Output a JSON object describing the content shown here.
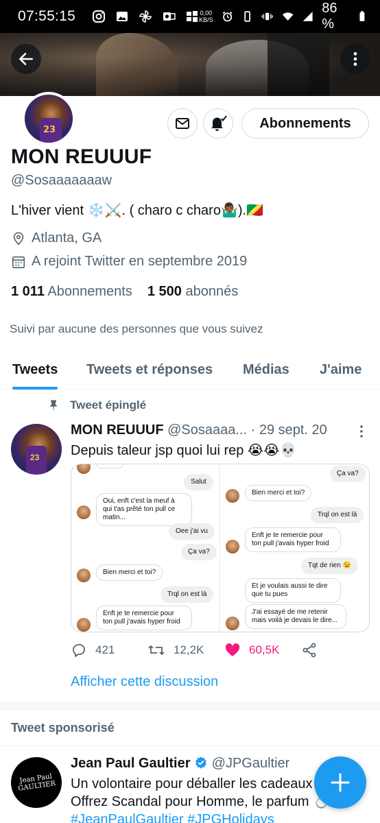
{
  "status_bar": {
    "time": "07:55:15",
    "net_speed_value": "0,00",
    "net_speed_unit": "KB/S",
    "battery": "86 %"
  },
  "profile": {
    "display_name": "MON REUUUF",
    "handle": "@Sosaaaaaaaw",
    "bio": "L'hiver vient ❄️⚔️. ( charo c charo🤷🏾‍♂️).🇨🇬",
    "location": "Atlanta, GA",
    "joined": "A rejoint Twitter en septembre 2019",
    "following_count": "1 011",
    "following_label": "Abonnements",
    "followers_count": "1 500",
    "followers_label": "abonnés",
    "followed_by": "Suivi par aucune des personnes que vous suivez",
    "follow_button": "Abonnements"
  },
  "tabs": [
    {
      "label": "Tweets",
      "active": true
    },
    {
      "label": "Tweets et réponses",
      "active": false
    },
    {
      "label": "Médias",
      "active": false
    },
    {
      "label": "J'aime",
      "active": false
    }
  ],
  "pinned_tweet": {
    "pinned_label": "Tweet épinglé",
    "author_name": "MON REUUUF",
    "author_handle": "@Sosaaaa...",
    "date": "· 29 sept. 20",
    "text": "Depuis taleur jsp quoi lui rep 😭😭💀",
    "media_left": [
      {
        "text": "Salut",
        "from": "me"
      },
      {
        "text": "Oui, enft c'est la meuf à qui t'as prêté ton pull ce matin...",
        "from": "them"
      },
      {
        "text": "Oee j'ai vu",
        "from": "me"
      },
      {
        "text": "Ça va?",
        "from": "me"
      },
      {
        "text": "Bien merci et toi?",
        "from": "them"
      },
      {
        "text": "Trql on est là",
        "from": "me"
      },
      {
        "text": "Enft je te remercie pour ton pull j'avais hyper froid",
        "from": "them"
      }
    ],
    "media_right": [
      {
        "text": "Ça va?",
        "from": "me"
      },
      {
        "text": "Bien merci et toi?",
        "from": "them"
      },
      {
        "text": "Trql on est là",
        "from": "me"
      },
      {
        "text": "Enft je te remercie pour ton pull j'avais hyper froid",
        "from": "them"
      },
      {
        "text": "Tqt de rien 😉",
        "from": "me"
      },
      {
        "text": "Et je voulais aussi te dire que tu pues",
        "from": "them"
      },
      {
        "text": "J'ai essayé de me retenir mais voilà je devais le dire...",
        "from": "them"
      }
    ],
    "replies": "421",
    "retweets": "12,2K",
    "likes": "60,5K",
    "show_thread": "Afficher cette discussion"
  },
  "sponsored": {
    "label": "Tweet sponsorisé",
    "author_name": "Jean Paul Gaultier",
    "author_handle": "@JPGaultier",
    "avatar_text_1": "Jean Paul",
    "avatar_text_2": "GAULTIER",
    "line1": "Un volontaire pour déballer les cadeaux ?",
    "line2": "Offrez Scandal pour Homme, le parfum 💍",
    "tags": "#JeanPaulGaultier #JPGHolidays"
  },
  "colors": {
    "accent": "#1d9bf0",
    "like": "#f91880",
    "secondary_text": "#536471"
  }
}
